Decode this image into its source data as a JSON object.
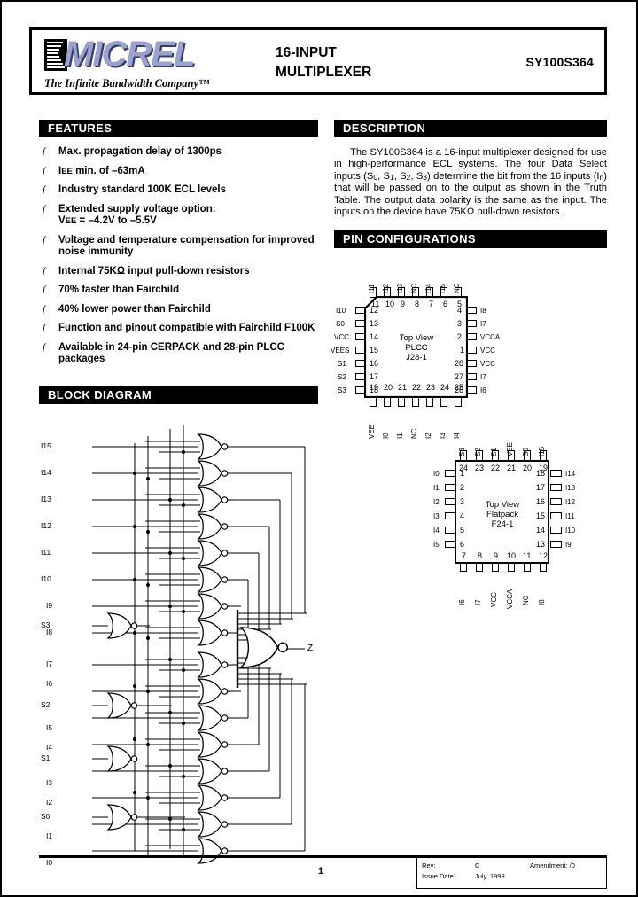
{
  "header": {
    "logo_text": "MICREL",
    "tagline": "The Infinite Bandwidth Company™",
    "title_line1": "16-INPUT",
    "title_line2": "MULTIPLEXER",
    "part_number": "SY100S364"
  },
  "sections": {
    "features": "FEATURES",
    "description": "DESCRIPTION",
    "pin_configurations": "PIN CONFIGURATIONS",
    "block_diagram": "BLOCK DIAGRAM"
  },
  "features": [
    "Max. propagation delay of 1300ps",
    "IEE min. of –63mA",
    "Industry standard 100K ECL levels",
    "Extended supply voltage option: VEE = –4.2V to –5.5V",
    "Voltage and temperature compensation for improved noise immunity",
    "Internal 75KΩ input pull-down resistors",
    "70% faster than Fairchild",
    "40% lower power than Fairchild",
    "Function and pinout compatible with Fairchild F100K",
    "Available in 24-pin CERPACK and 28-pin PLCC packages"
  ],
  "feature_bullet": "ſ",
  "description_text": "The SY100S364 is a 16-input multiplexer designed for use in high-performance ECL systems. The four Data Select inputs (S0, S1, S2, S3) determine the bit from the 16 inputs (In) that will be passed on to the output as shown in the Truth Table. The output data polarity is the same as the input. The inputs on the device have 75KΩ pull-down resistors.",
  "plcc": {
    "caption_line1": "Top View",
    "caption_line2": "PLCC",
    "caption_line3": "J28-1",
    "top_pins": [
      "11",
      "10",
      "9",
      "8",
      "7",
      "6",
      "5"
    ],
    "top_names": [
      "I11",
      "I12",
      "I13",
      "NC",
      "I14",
      "I15",
      "NC"
    ],
    "left_pins": [
      "12",
      "13",
      "14",
      "15",
      "16",
      "17",
      "18"
    ],
    "left_names": [
      "I10",
      "S0",
      "VCC",
      "VEES",
      "S1",
      "S2",
      "S3"
    ],
    "right_pins": [
      "4",
      "3",
      "2",
      "1",
      "28",
      "27",
      "26"
    ],
    "right_names": [
      "I8",
      "I7",
      "VCCA",
      "VCC",
      "VCC",
      "I7",
      "I6"
    ],
    "bottom_pins": [
      "19",
      "20",
      "21",
      "22",
      "23",
      "24",
      "25"
    ],
    "bottom_names": [
      "VEE",
      "I0",
      "I1",
      "NC",
      "I2",
      "I3",
      "I4"
    ]
  },
  "flatpack": {
    "caption_line1": "Top View",
    "caption_line2": "Flatpack",
    "caption_line3": "F24-1",
    "top_pins": [
      "24",
      "23",
      "22",
      "21",
      "20",
      "19"
    ],
    "top_names": [
      "S3",
      "S2",
      "S1",
      "VEE",
      "S0",
      "I15"
    ],
    "left_pins": [
      "1",
      "2",
      "3",
      "4",
      "5",
      "6"
    ],
    "left_names": [
      "I0",
      "I1",
      "I2",
      "I3",
      "I4",
      "I5"
    ],
    "right_pins": [
      "18",
      "17",
      "16",
      "15",
      "14",
      "13"
    ],
    "right_names": [
      "I14",
      "I13",
      "I12",
      "I11",
      "I10",
      "I9"
    ],
    "bottom_pins": [
      "7",
      "8",
      "9",
      "10",
      "11",
      "12"
    ],
    "bottom_names": [
      "I6",
      "I7",
      "VCC",
      "VCCA",
      "NC",
      "I8"
    ]
  },
  "block_diagram": {
    "inputs": [
      "I15",
      "I14",
      "I13",
      "I12",
      "I11",
      "I10",
      "I9",
      "I8",
      "S3",
      "I7",
      "I6",
      "S2",
      "I5",
      "I4",
      "S1",
      "I3",
      "I2",
      "S0",
      "I1",
      "I0"
    ],
    "output": "Z",
    "gate_count": 16,
    "select_inverters": [
      "S3",
      "S2",
      "S1",
      "S0"
    ]
  },
  "footer": {
    "page_number": "1",
    "rev_key": "Rev:",
    "rev_value": "C",
    "amendment_key": "Amendment:",
    "amendment_value": "/0",
    "issue_key": "Issue Date:",
    "issue_value": "July, 1999"
  }
}
